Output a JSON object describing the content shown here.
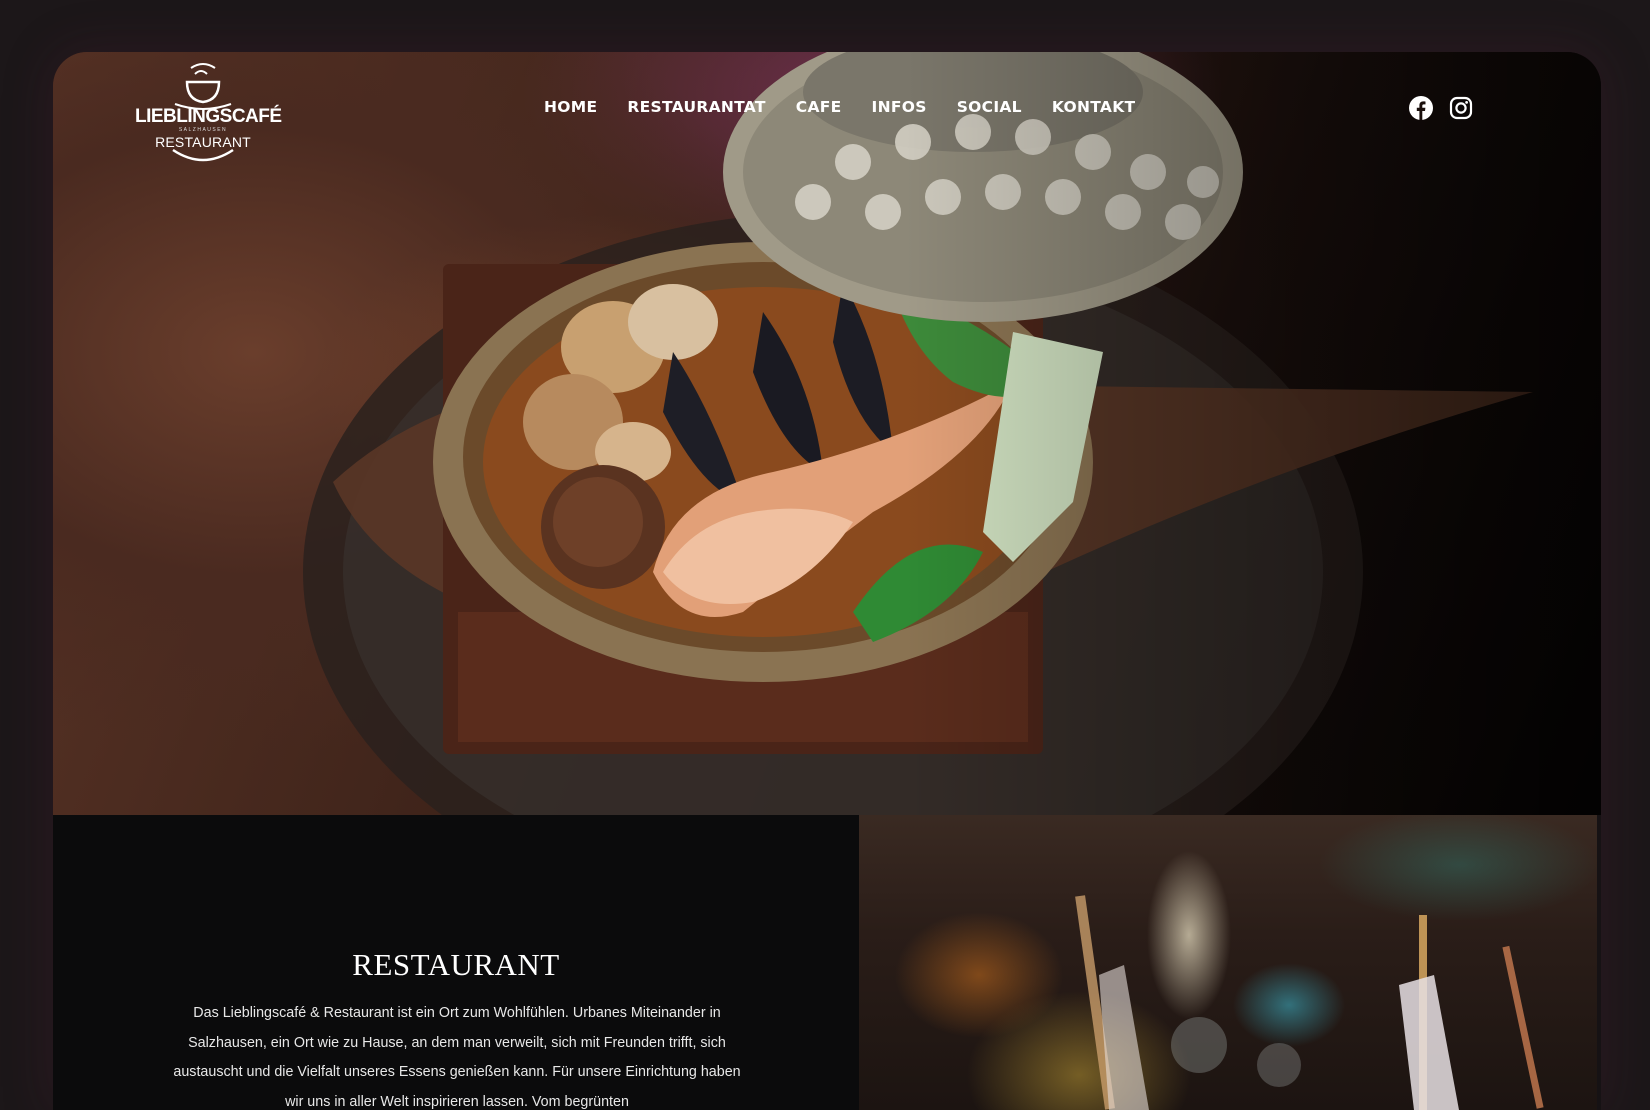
{
  "logo": {
    "top": "LIEBLINGSCAFÉ",
    "sub": "SALZHAUSEN",
    "bottom": "RESTAURANT"
  },
  "nav": {
    "items": [
      {
        "label": "HOME"
      },
      {
        "label": "RESTAURANTAT"
      },
      {
        "label": "CAFE"
      },
      {
        "label": "INFOS"
      },
      {
        "label": "SOCIAL"
      },
      {
        "label": "KONTAKT"
      }
    ]
  },
  "social": {
    "icons": [
      "facebook-icon",
      "instagram-icon"
    ]
  },
  "restaurant": {
    "heading": "RESTAURANT",
    "text": "Das Lieblingscafé & Restaurant ist ein Ort zum Wohlfühlen. Urbanes Miteinander in Salzhausen, ein Ort wie zu Hause, an dem man verweilt, sich mit Freunden trifft, sich austauscht und die Vielfalt unseres Essens genießen kann. Für unsere Einrichtung haben wir uns in aller Welt inspirieren lassen. Vom begrünten"
  },
  "colors": {
    "page_bg": "#1c1719",
    "content_bg": "#0b0b0c",
    "text": "#ffffff"
  }
}
